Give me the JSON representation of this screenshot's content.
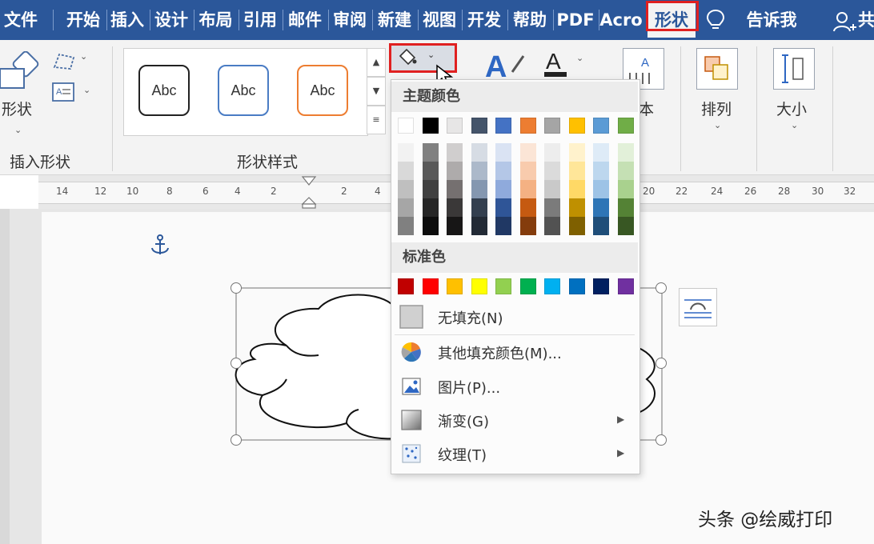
{
  "tabs": [
    "文件",
    "开始",
    "插入",
    "设计",
    "布局",
    "引用",
    "邮件",
    "审阅",
    "新建",
    "视图",
    "开发",
    "帮助",
    "PDF",
    "Acro"
  ],
  "active_tab": "形状",
  "tell_me": "告诉我",
  "share_fragment": "共",
  "ribbon": {
    "insert_shape_big_label": "形状",
    "insert_shape_group": "插入形状",
    "shape_styles_group": "形状样式",
    "style_sample_text": "Abc",
    "text_label": "本",
    "arrange_label": "排列",
    "size_label": "大小"
  },
  "ruler_labels": [
    "14",
    "12",
    "10",
    "8",
    "6",
    "4",
    "2",
    "2",
    "4",
    "20",
    "22",
    "24",
    "26",
    "28",
    "30",
    "32"
  ],
  "fill_menu": {
    "theme_colors_header": "主题颜色",
    "standard_colors_header": "标准色",
    "theme_top_colors": [
      "#ffffff",
      "#000000",
      "#e7e6e6",
      "#44546a",
      "#4472c4",
      "#ed7d31",
      "#a5a5a5",
      "#ffc000",
      "#5b9bd5",
      "#70ad47"
    ],
    "theme_shades": [
      [
        "#f2f2f2",
        "#d9d9d9",
        "#bfbfbf",
        "#a6a6a6",
        "#808080"
      ],
      [
        "#808080",
        "#595959",
        "#404040",
        "#262626",
        "#0d0d0d"
      ],
      [
        "#d0cece",
        "#aeabab",
        "#757070",
        "#3a3838",
        "#171616"
      ],
      [
        "#d6dce4",
        "#acb9ca",
        "#8497b0",
        "#333f4f",
        "#222a35"
      ],
      [
        "#dae3f3",
        "#b4c7e7",
        "#8faadc",
        "#2f5597",
        "#203864"
      ],
      [
        "#fbe5d6",
        "#f8cbad",
        "#f4b183",
        "#c55a11",
        "#843c0c"
      ],
      [
        "#ededed",
        "#dbdbdb",
        "#c9c9c9",
        "#7b7b7b",
        "#525252"
      ],
      [
        "#fff2cc",
        "#ffe699",
        "#ffd966",
        "#bf9000",
        "#7f6000"
      ],
      [
        "#deebf7",
        "#bdd7ee",
        "#9dc3e6",
        "#2e75b6",
        "#1f4e79"
      ],
      [
        "#e2f0d9",
        "#c5e0b4",
        "#a9d18e",
        "#548235",
        "#385723"
      ]
    ],
    "standard_colors": [
      "#c00000",
      "#ff0000",
      "#ffc000",
      "#ffff00",
      "#92d050",
      "#00b050",
      "#00b0f0",
      "#0070c0",
      "#002060",
      "#7030a0"
    ],
    "items": [
      {
        "label": "无填充(N)",
        "icon": "no-fill-icon",
        "submenu": false
      },
      {
        "label": "其他填充颜色(M)...",
        "icon": "color-wheel-icon",
        "submenu": false
      },
      {
        "label": "图片(P)...",
        "icon": "picture-icon",
        "submenu": false
      },
      {
        "label": "渐变(G)",
        "icon": "gradient-icon",
        "submenu": true
      },
      {
        "label": "纹理(T)",
        "icon": "texture-icon",
        "submenu": true
      }
    ]
  },
  "watermark": "头条 @绘威打印",
  "colors": {
    "tab_bar": "#2b579a",
    "highlight_box": "#e02020",
    "anchor": "#2b579a"
  }
}
